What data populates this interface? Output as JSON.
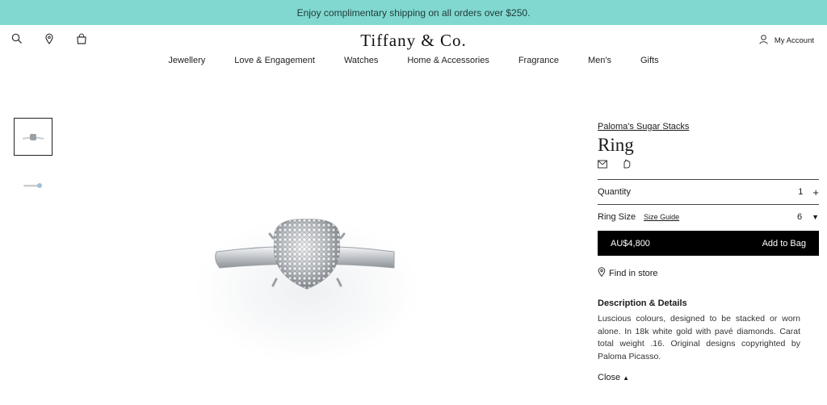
{
  "promo": {
    "text": "Enjoy complimentary shipping on all orders over $250."
  },
  "header": {
    "logo": "Tiffany & Co.",
    "account_label": "My Account"
  },
  "nav": {
    "items": [
      "Jewellery",
      "Love & Engagement",
      "Watches",
      "Home & Accessories",
      "Fragrance",
      "Men's",
      "Gifts"
    ]
  },
  "product": {
    "collection": "Paloma's Sugar Stacks",
    "title": "Ring",
    "quantity_label": "Quantity",
    "quantity_value": "1",
    "size_label": "Ring Size",
    "size_guide": "Size Guide",
    "size_value": "6",
    "price": "AU$4,800",
    "add_label": "Add to Bag",
    "find_store": "Find in store",
    "desc_heading": "Description & Details",
    "desc_text": "Luscious colours, designed to be stacked or worn alone. In 18k white gold with pavé diamonds. Carat total weight .16. Original designs copyrighted by Paloma Picasso.",
    "close_label": "Close"
  },
  "colors": {
    "promo_bg": "#81d8d0",
    "button_bg": "#000000"
  }
}
